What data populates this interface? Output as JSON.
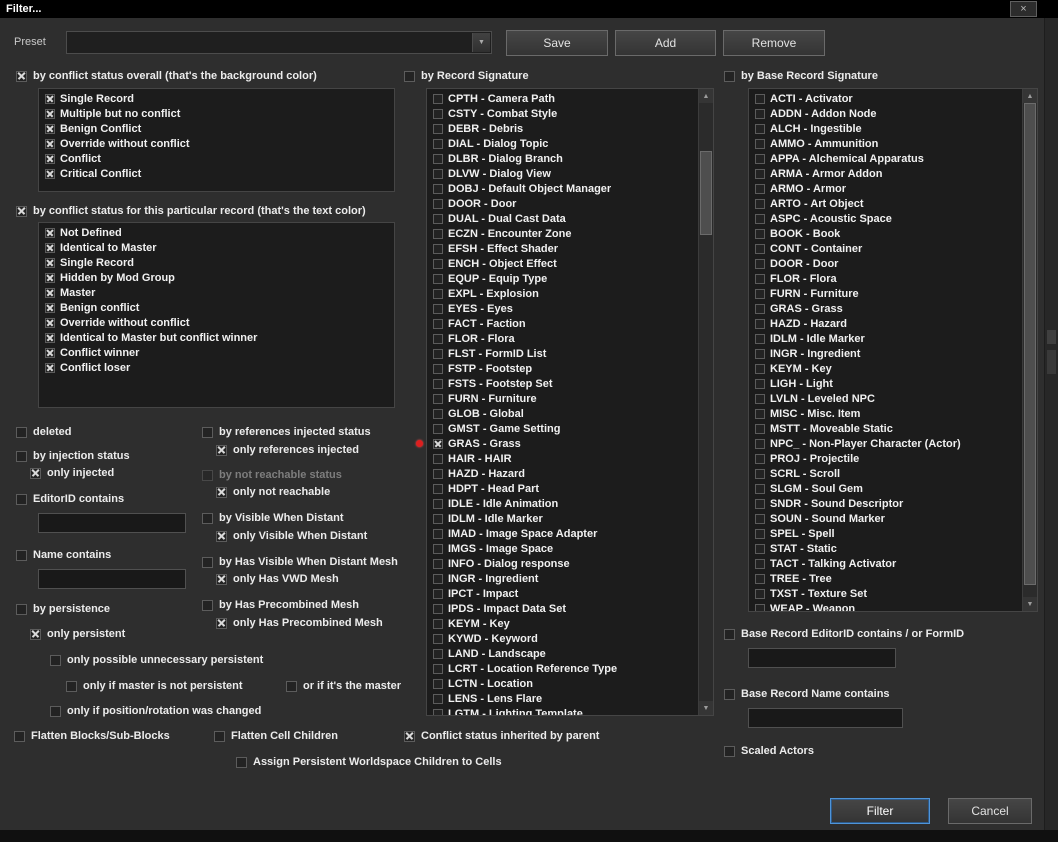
{
  "window": {
    "title": "Filter...",
    "close_icon": "×"
  },
  "icons": {
    "dropdown": "▼",
    "scroll_up": "▲",
    "scroll_down": "▼"
  },
  "preset": {
    "label": "Preset",
    "value": "",
    "save_label": "Save",
    "add_label": "Add",
    "remove_label": "Remove"
  },
  "conflict_overall": {
    "label": "by conflict status overall (that's the background color)",
    "checked": true,
    "items": [
      {
        "label": "Single Record",
        "checked": true
      },
      {
        "label": "Multiple but no conflict",
        "checked": true
      },
      {
        "label": "Benign Conflict",
        "checked": true
      },
      {
        "label": "Override without conflict",
        "checked": true
      },
      {
        "label": "Conflict",
        "checked": true
      },
      {
        "label": "Critical Conflict",
        "checked": true
      }
    ]
  },
  "conflict_particular": {
    "label": "by conflict status for this particular record  (that's the text color)",
    "checked": true,
    "items": [
      {
        "label": "Not Defined",
        "checked": true
      },
      {
        "label": "Identical to Master",
        "checked": true
      },
      {
        "label": "Single Record",
        "checked": true
      },
      {
        "label": "Hidden by Mod Group",
        "checked": true
      },
      {
        "label": "Master",
        "checked": true
      },
      {
        "label": "Benign conflict",
        "checked": true
      },
      {
        "label": "Override without conflict",
        "checked": true
      },
      {
        "label": "Identical to Master but conflict winner",
        "checked": true
      },
      {
        "label": "Conflict winner",
        "checked": true
      },
      {
        "label": "Conflict loser",
        "checked": true
      }
    ]
  },
  "left": {
    "deleted": {
      "label": "deleted",
      "checked": false
    },
    "by_injection": {
      "label": "by injection status",
      "checked": false
    },
    "only_injected": {
      "label": "only injected",
      "checked": true
    },
    "editorid": {
      "label": "EditorID contains",
      "checked": false,
      "value": ""
    },
    "name_contains": {
      "label": "Name contains",
      "checked": false,
      "value": ""
    },
    "by_persistence": {
      "label": "by persistence",
      "checked": false
    },
    "only_persistent": {
      "label": "only persistent",
      "checked": true
    },
    "only_unnecessary": {
      "label": "only possible unnecessary persistent",
      "checked": false
    },
    "only_master_not_persistent": {
      "label": "only if master is not persistent",
      "checked": false
    },
    "or_if_master": {
      "label": "or if it's the master",
      "checked": false
    },
    "only_position_changed": {
      "label": "only if position/rotation was changed",
      "checked": false
    },
    "flatten_blocks": {
      "label": "Flatten Blocks/Sub-Blocks",
      "checked": false
    },
    "flatten_cells": {
      "label": "Flatten Cell Children",
      "checked": false
    }
  },
  "mid": {
    "by_ref_injected": {
      "label": "by references injected status",
      "checked": false
    },
    "only_ref_injected": {
      "label": "only references injected",
      "checked": true
    },
    "by_not_reachable": {
      "label": "by not reachable status",
      "checked": false
    },
    "only_not_reachable": {
      "label": "only not reachable",
      "checked": true
    },
    "by_vwd": {
      "label": "by Visible When Distant",
      "checked": false
    },
    "only_vwd": {
      "label": "only Visible When Distant",
      "checked": true
    },
    "by_has_vwd_mesh": {
      "label": "by Has Visible When Distant Mesh",
      "checked": false
    },
    "only_has_vwd_mesh": {
      "label": "only Has VWD Mesh",
      "checked": true
    },
    "by_precombined": {
      "label": "by Has Precombined Mesh",
      "checked": false
    },
    "only_precombined": {
      "label": "only Has Precombined Mesh",
      "checked": true
    }
  },
  "record_signature": {
    "label": "by Record Signature",
    "checked": false,
    "items": [
      {
        "label": "CPTH - Camera Path",
        "checked": false
      },
      {
        "label": "CSTY - Combat Style",
        "checked": false
      },
      {
        "label": "DEBR - Debris",
        "checked": false
      },
      {
        "label": "DIAL - Dialog Topic",
        "checked": false
      },
      {
        "label": "DLBR - Dialog Branch",
        "checked": false
      },
      {
        "label": "DLVW - Dialog View",
        "checked": false
      },
      {
        "label": "DOBJ - Default Object Manager",
        "checked": false
      },
      {
        "label": "DOOR - Door",
        "checked": false
      },
      {
        "label": "DUAL - Dual Cast Data",
        "checked": false
      },
      {
        "label": "ECZN - Encounter Zone",
        "checked": false
      },
      {
        "label": "EFSH - Effect Shader",
        "checked": false
      },
      {
        "label": "ENCH - Object Effect",
        "checked": false
      },
      {
        "label": "EQUP - Equip Type",
        "checked": false
      },
      {
        "label": "EXPL - Explosion",
        "checked": false
      },
      {
        "label": "EYES - Eyes",
        "checked": false
      },
      {
        "label": "FACT - Faction",
        "checked": false
      },
      {
        "label": "FLOR - Flora",
        "checked": false
      },
      {
        "label": "FLST - FormID List",
        "checked": false
      },
      {
        "label": "FSTP - Footstep",
        "checked": false
      },
      {
        "label": "FSTS - Footstep Set",
        "checked": false
      },
      {
        "label": "FURN - Furniture",
        "checked": false
      },
      {
        "label": "GLOB - Global",
        "checked": false
      },
      {
        "label": "GMST - Game Setting",
        "checked": false
      },
      {
        "label": "GRAS - Grass",
        "checked": true
      },
      {
        "label": "HAIR - HAIR",
        "checked": false
      },
      {
        "label": "HAZD - Hazard",
        "checked": false
      },
      {
        "label": "HDPT - Head Part",
        "checked": false
      },
      {
        "label": "IDLE - Idle Animation",
        "checked": false
      },
      {
        "label": "IDLM - Idle Marker",
        "checked": false
      },
      {
        "label": "IMAD - Image Space Adapter",
        "checked": false
      },
      {
        "label": "IMGS - Image Space",
        "checked": false
      },
      {
        "label": "INFO - Dialog response",
        "checked": false
      },
      {
        "label": "INGR - Ingredient",
        "checked": false
      },
      {
        "label": "IPCT - Impact",
        "checked": false
      },
      {
        "label": "IPDS - Impact Data Set",
        "checked": false
      },
      {
        "label": "KEYM - Key",
        "checked": false
      },
      {
        "label": "KYWD - Keyword",
        "checked": false
      },
      {
        "label": "LAND - Landscape",
        "checked": false
      },
      {
        "label": "LCRT - Location Reference Type",
        "checked": false
      },
      {
        "label": "LCTN - Location",
        "checked": false
      },
      {
        "label": "LENS - Lens Flare",
        "checked": false
      },
      {
        "label": "LGTM - Lighting Template",
        "checked": false
      }
    ]
  },
  "base_signature": {
    "label": "by Base Record Signature",
    "checked": false,
    "items": [
      {
        "label": "ACTI - Activator",
        "checked": false
      },
      {
        "label": "ADDN - Addon Node",
        "checked": false
      },
      {
        "label": "ALCH - Ingestible",
        "checked": false
      },
      {
        "label": "AMMO - Ammunition",
        "checked": false
      },
      {
        "label": "APPA - Alchemical Apparatus",
        "checked": false
      },
      {
        "label": "ARMA - Armor Addon",
        "checked": false
      },
      {
        "label": "ARMO - Armor",
        "checked": false
      },
      {
        "label": "ARTO - Art Object",
        "checked": false
      },
      {
        "label": "ASPC - Acoustic Space",
        "checked": false
      },
      {
        "label": "BOOK - Book",
        "checked": false
      },
      {
        "label": "CONT - Container",
        "checked": false
      },
      {
        "label": "DOOR - Door",
        "checked": false
      },
      {
        "label": "FLOR - Flora",
        "checked": false
      },
      {
        "label": "FURN - Furniture",
        "checked": false
      },
      {
        "label": "GRAS - Grass",
        "checked": false
      },
      {
        "label": "HAZD - Hazard",
        "checked": false
      },
      {
        "label": "IDLM - Idle Marker",
        "checked": false
      },
      {
        "label": "INGR - Ingredient",
        "checked": false
      },
      {
        "label": "KEYM - Key",
        "checked": false
      },
      {
        "label": "LIGH - Light",
        "checked": false
      },
      {
        "label": "LVLN - Leveled NPC",
        "checked": false
      },
      {
        "label": "MISC - Misc. Item",
        "checked": false
      },
      {
        "label": "MSTT - Moveable Static",
        "checked": false
      },
      {
        "label": "NPC_ - Non-Player Character (Actor)",
        "checked": false
      },
      {
        "label": "PROJ - Projectile",
        "checked": false
      },
      {
        "label": "SCRL - Scroll",
        "checked": false
      },
      {
        "label": "SLGM - Soul Gem",
        "checked": false
      },
      {
        "label": "SNDR - Sound Descriptor",
        "checked": false
      },
      {
        "label": "SOUN - Sound Marker",
        "checked": false
      },
      {
        "label": "SPEL - Spell",
        "checked": false
      },
      {
        "label": "STAT - Static",
        "checked": false
      },
      {
        "label": "TACT - Talking Activator",
        "checked": false
      },
      {
        "label": "TREE - Tree",
        "checked": false
      },
      {
        "label": "TXST - Texture Set",
        "checked": false
      },
      {
        "label": "WEAP - Weapon",
        "checked": false
      }
    ]
  },
  "bottom": {
    "conflict_inherited": {
      "label": "Conflict status inherited by parent",
      "checked": true
    },
    "assign_persistent": {
      "label": "Assign Persistent Worldspace Children to Cells",
      "checked": false
    },
    "base_editorid": {
      "label": "Base Record EditorID contains / or FormID",
      "checked": false,
      "value": ""
    },
    "base_name": {
      "label": "Base Record Name contains",
      "checked": false,
      "value": ""
    },
    "scaled_actors": {
      "label": "Scaled Actors",
      "checked": false
    }
  },
  "actions": {
    "filter_label": "Filter",
    "cancel_label": "Cancel"
  }
}
